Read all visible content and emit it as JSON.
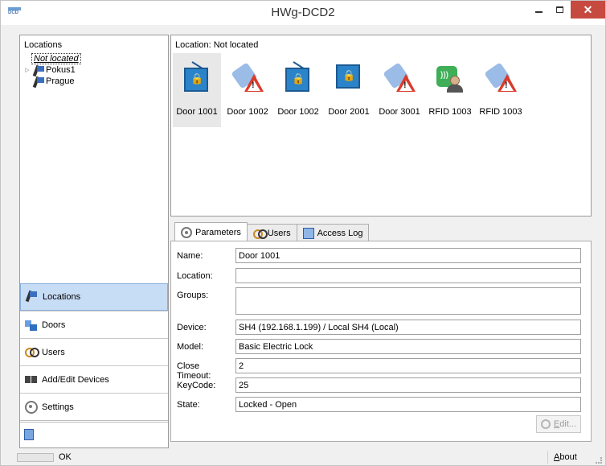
{
  "window": {
    "title": "HWg-DCD2",
    "icon_text": "DCD",
    "close_glyph": "✕"
  },
  "locations_panel": {
    "header": "Locations",
    "tree": [
      {
        "label": "Not located",
        "selected": true,
        "expandable": false
      },
      {
        "label": "Pokus1",
        "selected": false,
        "expandable": true
      },
      {
        "label": "Prague",
        "selected": false,
        "expandable": false
      }
    ],
    "expand_glyph": "▷"
  },
  "nav": {
    "items": [
      {
        "label": "Locations",
        "icon": "location-pin-icon",
        "active": true
      },
      {
        "label": "Doors",
        "icon": "doors-icon",
        "active": false
      },
      {
        "label": "Users",
        "icon": "users-icon",
        "active": false
      },
      {
        "label": "Add/Edit Devices",
        "icon": "devices-icon",
        "active": false
      },
      {
        "label": "Settings",
        "icon": "gear-icon",
        "active": false
      }
    ],
    "bottom_icon": "log-icon"
  },
  "location_view": {
    "header": "Location: Not located",
    "devices": [
      {
        "label": "Door 1001",
        "icon": "door-lock-icon",
        "selected": true
      },
      {
        "label": "Door 1002",
        "icon": "disconnected-warning-icon",
        "selected": false
      },
      {
        "label": "Door 1002",
        "icon": "door-lock-icon",
        "selected": false
      },
      {
        "label": "Door 2001",
        "icon": "door-lock-icon",
        "selected": false
      },
      {
        "label": "Door 3001",
        "icon": "disconnected-warning-icon",
        "selected": false
      },
      {
        "label": "RFID 1003",
        "icon": "rfid-user-icon",
        "selected": false
      },
      {
        "label": "RFID 1003",
        "icon": "disconnected-warning-icon",
        "selected": false
      }
    ]
  },
  "details": {
    "tabs": [
      {
        "label": "Parameters",
        "icon": "gear-icon",
        "active": true
      },
      {
        "label": "Users",
        "icon": "users-icon",
        "active": false
      },
      {
        "label": "Access Log",
        "icon": "log-icon",
        "active": false
      }
    ],
    "fields": {
      "name": {
        "label": "Name:",
        "value": "Door 1001"
      },
      "location": {
        "label": "Location:",
        "value": ""
      },
      "groups": {
        "label": "Groups:",
        "value": ""
      },
      "device": {
        "label": "Device:",
        "value": "SH4 (192.168.1.199) / Local SH4 (Local)"
      },
      "model": {
        "label": "Model:",
        "value": "Basic Electric Lock"
      },
      "close_timeout": {
        "label": "Close Timeout:",
        "value": "2"
      },
      "keycode": {
        "label": "KeyCode:",
        "value": "25"
      },
      "state": {
        "label": "State:",
        "value": "Locked - Open"
      }
    },
    "edit_button": "Edit..."
  },
  "status_bar": {
    "status": "OK",
    "progress": 0.0,
    "about": "About"
  }
}
